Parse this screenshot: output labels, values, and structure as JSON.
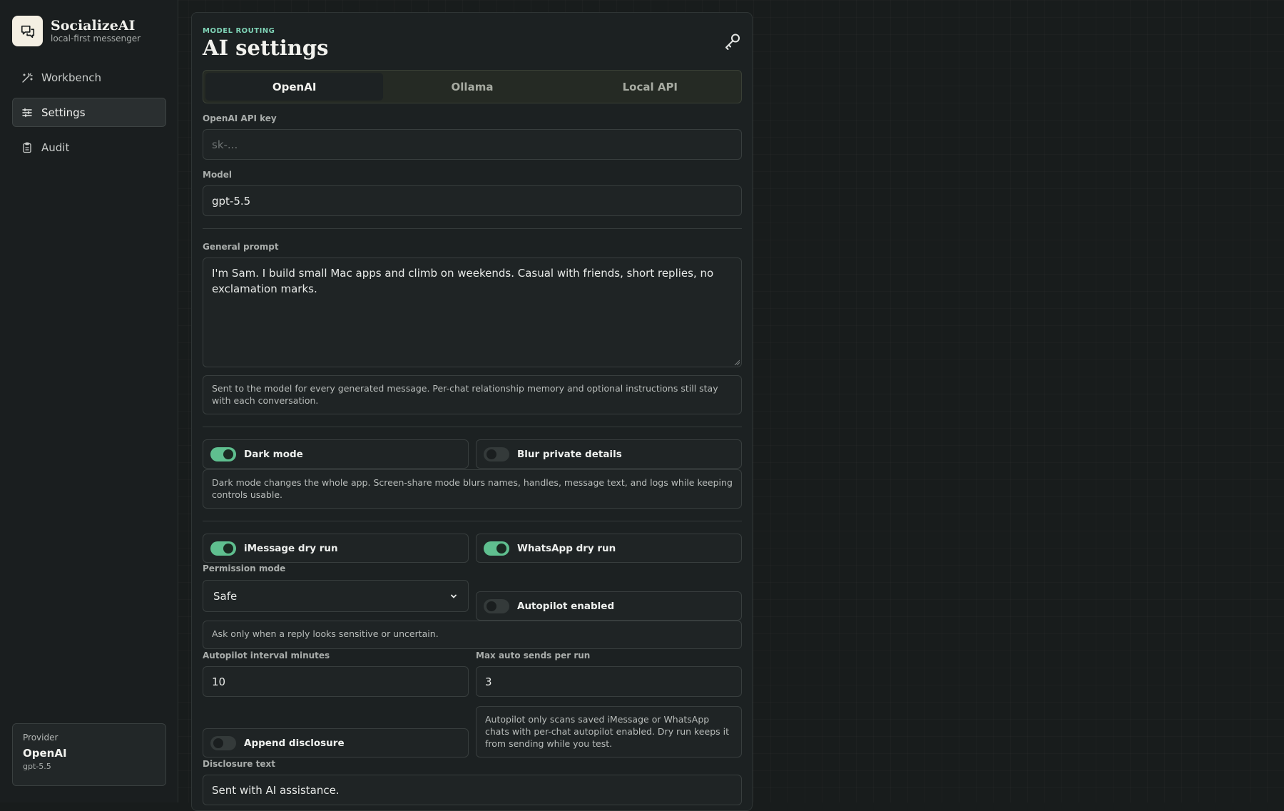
{
  "app": {
    "name": "SocializeAI",
    "tagline": "local-first messenger"
  },
  "nav": {
    "items": [
      {
        "label": "Workbench",
        "icon": "wand-icon"
      },
      {
        "label": "Settings",
        "icon": "sliders-icon"
      },
      {
        "label": "Audit",
        "icon": "clipboard-icon"
      }
    ],
    "active": "Settings"
  },
  "provider_card": {
    "label": "Provider",
    "name": "OpenAI",
    "model": "gpt-5.5"
  },
  "page": {
    "eyebrow": "MODEL ROUTING",
    "title": "AI settings"
  },
  "tabs": [
    {
      "label": "OpenAI",
      "active": true
    },
    {
      "label": "Ollama",
      "active": false
    },
    {
      "label": "Local API",
      "active": false
    }
  ],
  "openai": {
    "api_key_label": "OpenAI API key",
    "api_key_placeholder": "sk-...",
    "model_label": "Model",
    "model_value": "gpt-5.5"
  },
  "prompt": {
    "label": "General prompt",
    "value": "I'm Sam. I build small Mac apps and climb on weekends. Casual with friends, short replies, no exclamation marks.",
    "note": "Sent to the model for every generated message. Per-chat relationship memory and optional instructions still stay with each conversation."
  },
  "display": {
    "dark_mode_label": "Dark mode",
    "dark_mode_on": true,
    "blur_label": "Blur private details",
    "blur_on": false,
    "note": "Dark mode changes the whole app. Screen-share mode blurs names, handles, message text, and logs while keeping controls usable."
  },
  "sending": {
    "imessage_dry_run_label": "iMessage dry run",
    "imessage_dry_run_on": true,
    "whatsapp_dry_run_label": "WhatsApp dry run",
    "whatsapp_dry_run_on": true,
    "permission_label": "Permission mode",
    "permission_value": "Safe",
    "autopilot_label": "Autopilot enabled",
    "autopilot_on": false,
    "permission_note": "Ask only when a reply looks sensitive or uncertain.",
    "interval_label": "Autopilot interval minutes",
    "interval_value": "10",
    "max_sends_label": "Max auto sends per run",
    "max_sends_value": "3",
    "autopilot_note": "Autopilot only scans saved iMessage or WhatsApp chats with per-chat autopilot enabled. Dry run keeps it from sending while you test.",
    "disclosure_toggle_label": "Append disclosure",
    "disclosure_on": false,
    "disclosure_text_label": "Disclosure text",
    "disclosure_text_value": "Sent with AI assistance."
  },
  "colors": {
    "accent": "#7fd3b6",
    "toggle_on": "#5fbf8f",
    "background": "#181c1c"
  }
}
